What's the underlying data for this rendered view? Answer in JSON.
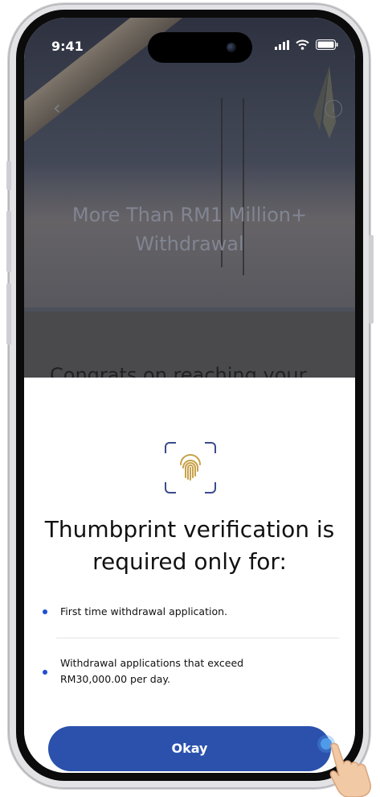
{
  "status_bar": {
    "time": "9:41"
  },
  "hero": {
    "title": "More Than RM1 Million+ Withdrawal"
  },
  "card": {
    "congrats": "Congrats on reaching your"
  },
  "sheet": {
    "title": "Thumbprint verification is required only for:",
    "items": [
      {
        "text": "First time withdrawal application."
      },
      {
        "text": "Withdrawal applications that exceed RM30,000.00 per day."
      }
    ],
    "okay_label": "Okay"
  },
  "colors": {
    "accent": "#2b51ac",
    "fingerprint": "#c8a24a",
    "scan_frame": "#3b4b8c",
    "bullet": "#1f4fd0"
  }
}
